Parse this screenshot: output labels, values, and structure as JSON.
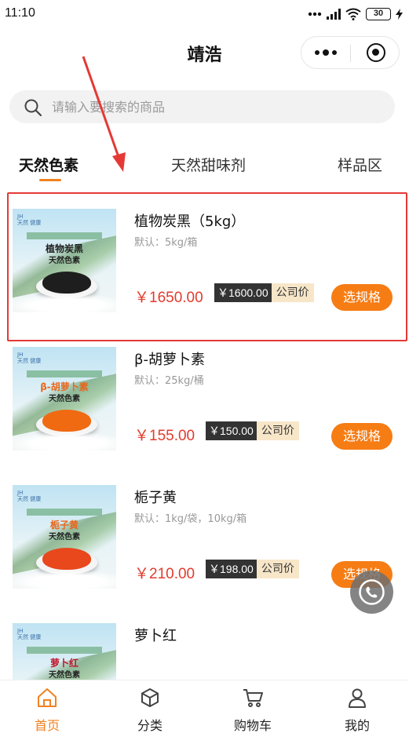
{
  "status_bar": {
    "time": "11:10",
    "battery": "30"
  },
  "nav": {
    "title": "靖浩"
  },
  "search": {
    "placeholder": "请输入要搜索的商品"
  },
  "tabs": [
    {
      "label": "天然色素",
      "active": true
    },
    {
      "label": "天然甜味剂",
      "active": false
    },
    {
      "label": "样品区",
      "active": false
    }
  ],
  "products": [
    {
      "name": "植物炭黑（5kg）",
      "spec": "默认：5kg/箱",
      "price": "￥1650.00",
      "company_price": "￥1600.00",
      "company_price_label": "公司价",
      "button": "选规格",
      "image_title": "植物炭黑",
      "image_subtitle": "天然色素",
      "powder_color": "#1e1e1e"
    },
    {
      "name": "β-胡萝卜素",
      "spec": "默认：25kg/桶",
      "price": "￥155.00",
      "company_price": "￥150.00",
      "company_price_label": "公司价",
      "button": "选规格",
      "image_title": "β-胡萝卜素",
      "image_subtitle": "天然色素",
      "powder_color": "#f06a12"
    },
    {
      "name": "栀子黄",
      "spec": "默认：1kg/袋，10kg/箱",
      "price": "￥210.00",
      "company_price": "￥198.00",
      "company_price_label": "公司价",
      "button": "选规格",
      "image_title": "栀子黄",
      "image_subtitle": "天然色素",
      "powder_color": "#e8481c"
    },
    {
      "name": "萝卜红",
      "image_title": "萝卜红",
      "image_subtitle": "天然色素",
      "powder_color": "#c0142a"
    }
  ],
  "tabbar": [
    {
      "label": "首页",
      "icon": "home-icon",
      "active": true
    },
    {
      "label": "分类",
      "icon": "cube-icon",
      "active": false
    },
    {
      "label": "购物车",
      "icon": "cart-icon",
      "active": false
    },
    {
      "label": "我的",
      "icon": "user-icon",
      "active": false
    }
  ],
  "colors": {
    "accent": "#f08221",
    "price": "#e23b2e",
    "button": "#f67c14",
    "highlight": "#e53935"
  }
}
